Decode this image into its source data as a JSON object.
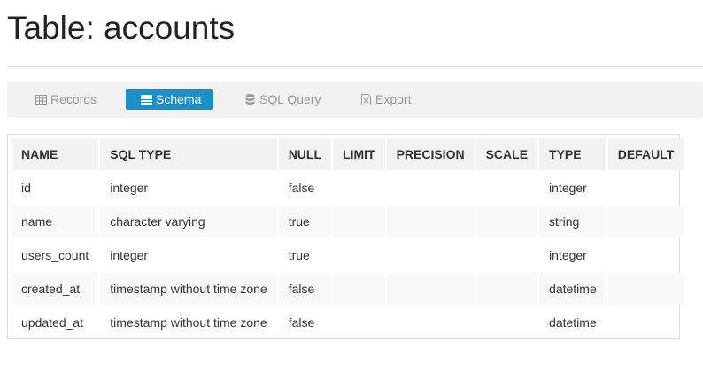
{
  "page": {
    "title": "Table: accounts"
  },
  "tabs": [
    {
      "label": "Records",
      "icon": "table-grid-icon",
      "active": false
    },
    {
      "label": "Schema",
      "icon": "list-icon",
      "active": true
    },
    {
      "label": "SQL Query",
      "icon": "database-icon",
      "active": false
    },
    {
      "label": "Export",
      "icon": "excel-file-icon",
      "active": false
    }
  ],
  "colors": {
    "accent": "#1a8fc9",
    "tab_bar": "#f2f2f2",
    "header_bg": "#f2f2f2"
  },
  "schema": {
    "columns": [
      "NAME",
      "SQL TYPE",
      "NULL",
      "LIMIT",
      "PRECISION",
      "SCALE",
      "TYPE",
      "DEFAULT"
    ],
    "rows": [
      [
        "id",
        "integer",
        "false",
        "",
        "",
        "",
        "integer",
        ""
      ],
      [
        "name",
        "character varying",
        "true",
        "",
        "",
        "",
        "string",
        ""
      ],
      [
        "users_count",
        "integer",
        "true",
        "",
        "",
        "",
        "integer",
        ""
      ],
      [
        "created_at",
        "timestamp without time zone",
        "false",
        "",
        "",
        "",
        "datetime",
        ""
      ],
      [
        "updated_at",
        "timestamp without time zone",
        "false",
        "",
        "",
        "",
        "datetime",
        ""
      ]
    ]
  }
}
